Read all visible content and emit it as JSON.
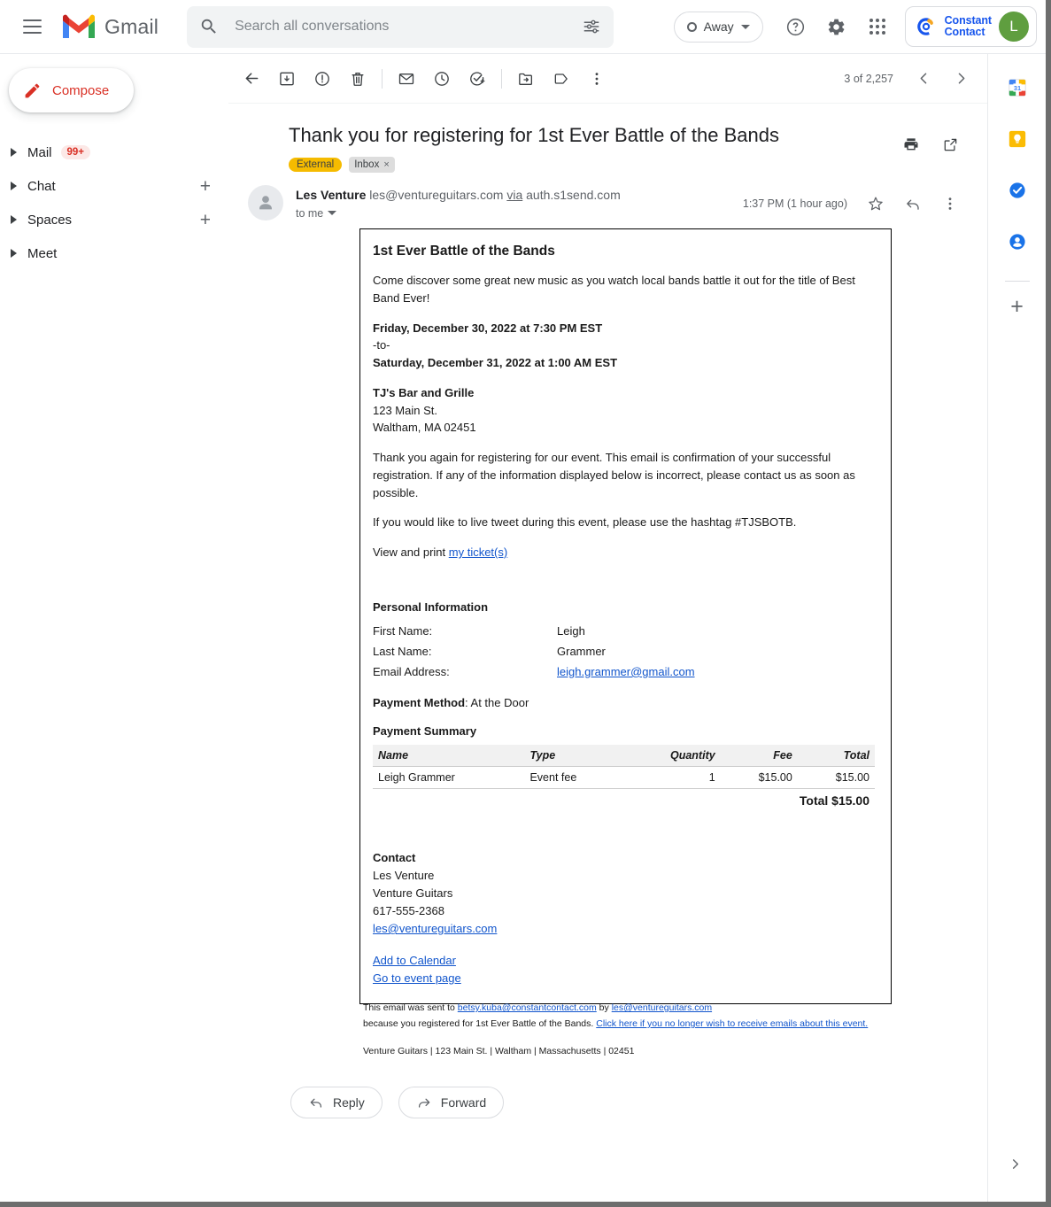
{
  "topbar": {
    "menu_icon": "hamburger-icon",
    "brand": "Gmail",
    "search": {
      "icon": "search-icon",
      "placeholder": "Search all conversations",
      "value": "",
      "options_icon": "search-options-icon"
    },
    "status": {
      "label": "Away",
      "icon": "status-circle-icon",
      "caret": "chevron-down-icon"
    },
    "help_icon": "help-icon",
    "settings_icon": "gear-icon",
    "apps_icon": "apps-grid-icon",
    "account": {
      "brand_line1": "Constant",
      "brand_line2": "Contact",
      "avatar_letter": "L",
      "avatar_color": "#5f9e3f",
      "brand_color": "#1856ed"
    }
  },
  "sidebar": {
    "compose": {
      "label": "Compose",
      "icon": "pencil-icon",
      "color": "#d93025"
    },
    "items": [
      {
        "label": "Mail",
        "badge": "99+",
        "has_plus": false
      },
      {
        "label": "Chat",
        "badge": "",
        "has_plus": true
      },
      {
        "label": "Spaces",
        "badge": "",
        "has_plus": true
      },
      {
        "label": "Meet",
        "badge": "",
        "has_plus": false
      }
    ]
  },
  "toolbar": {
    "back_icon": "back-arrow-icon",
    "archive_icon": "archive-icon",
    "spam_icon": "report-spam-icon",
    "delete_icon": "trash-icon",
    "unread_icon": "mark-unread-icon",
    "snooze_icon": "snooze-clock-icon",
    "task_icon": "add-to-tasks-icon",
    "move_icon": "move-to-folder-icon",
    "label_icon": "label-tag-icon",
    "more_icon": "more-vertical-icon",
    "pager_text": "3 of 2,257",
    "prev_icon": "chevron-left-icon",
    "next_icon": "chevron-right-icon"
  },
  "message": {
    "subject": "Thank you for registering for 1st Ever Battle of the Bands",
    "chips": {
      "external": "External",
      "inbox": "Inbox",
      "inbox_close": "×"
    },
    "print_icon": "print-icon",
    "popout_icon": "open-in-new-window-icon",
    "sender_name": "Les Venture",
    "sender_email": "les@ventureguitars.com",
    "via_word": "via",
    "via_domain": "auth.s1send.com",
    "recipient": "to me",
    "timestamp": "1:37 PM (1 hour ago)",
    "star_icon": "star-icon",
    "reply_icon": "reply-arrow-icon",
    "more_icon": "more-vertical-icon"
  },
  "email_body": {
    "title": "1st Ever Battle of the Bands",
    "intro": "Come discover some great new music as you watch local bands battle it out for the title of Best Band Ever!",
    "date_start": "Friday, December 30, 2022 at 7:30 PM EST",
    "date_sep": "-to-",
    "date_end": "Saturday, December 31, 2022 at 1:00 AM EST",
    "venue": "TJ's Bar and Grille",
    "venue_street": "123 Main St.",
    "venue_city": "Waltham, MA 02451",
    "thanks": "Thank you again for registering for our event. This email is confirmation of your successful registration. If any of the information displayed below is incorrect, please contact us as soon as possible.",
    "hashtag_line": "If you would like to live tweet during this event, please use the hashtag #TJSBOTB.",
    "ticket_prefix": "View and print ",
    "ticket_link": "my ticket(s)",
    "personal_info_heading": "Personal Information",
    "personal_info": [
      {
        "label": "First Name:",
        "value": "Leigh",
        "is_link": false
      },
      {
        "label": "Last Name:",
        "value": "Grammer",
        "is_link": false
      },
      {
        "label": "Email Address:",
        "value": "leigh.grammer@gmail.com",
        "is_link": true
      }
    ],
    "payment_method_label": "Payment Method",
    "payment_method_value": ": At the Door",
    "payment_summary_heading": "Payment Summary",
    "payment_table": {
      "columns": [
        "Name",
        "Type",
        "Quantity",
        "Fee",
        "Total"
      ],
      "rows": [
        {
          "name": "Leigh Grammer",
          "type": "Event fee",
          "quantity": "1",
          "fee": "$15.00",
          "total": "$15.00"
        }
      ],
      "total_label": "Total",
      "total_value": "$15.00"
    },
    "contact_heading": "Contact",
    "contact_name": "Les Venture",
    "contact_company": "Venture Guitars",
    "contact_phone": "617-555-2368",
    "contact_email": "les@ventureguitars.com",
    "link_calendar": "Add to Calendar",
    "link_event_page": "Go to event page"
  },
  "email_footer": {
    "sent_to_prefix": "This email was sent to ",
    "sent_to_email": "betsy.kuba@constantcontact.com",
    "sent_by_word": " by ",
    "sent_by_email": "les@ventureguitars.com",
    "because_text": "because you registered for 1st Ever Battle of the Bands. ",
    "unsubscribe_link": "Click here if you no longer wish to receive emails about this event.",
    "address_line": "Venture Guitars | 123 Main St. | Waltham | Massachusetts | 02451"
  },
  "annotation": {
    "type": "arrow",
    "color": "#FF0000",
    "direction": "left",
    "points_at": "#TJSBOTB"
  },
  "actions": {
    "reply": {
      "label": "Reply",
      "icon": "reply-arrow-icon"
    },
    "forward": {
      "label": "Forward",
      "icon": "forward-arrow-icon"
    }
  },
  "right_rail": {
    "items": [
      {
        "name": "google-calendar-icon",
        "label": "Calendar"
      },
      {
        "name": "google-keep-icon",
        "label": "Keep"
      },
      {
        "name": "google-tasks-icon",
        "label": "Tasks"
      },
      {
        "name": "google-contacts-icon",
        "label": "Contacts"
      }
    ],
    "add_label": "+",
    "expand_icon": "chevron-right-icon"
  }
}
